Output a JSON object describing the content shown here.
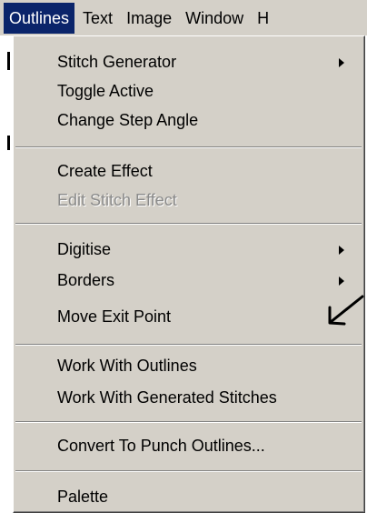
{
  "menubar": {
    "items": [
      {
        "label": "Outlines"
      },
      {
        "label": "Text"
      },
      {
        "label": "Image"
      },
      {
        "label": "Window"
      },
      {
        "label": "H"
      }
    ]
  },
  "menu": {
    "stitch_generator": "Stitch Generator",
    "toggle_active": "Toggle Active",
    "change_step_angle": "Change Step Angle",
    "create_effect": "Create Effect",
    "edit_stitch_effect": "Edit Stitch Effect",
    "digitise": "Digitise",
    "borders": "Borders",
    "move_exit_point": "Move Exit Point",
    "work_with_outlines": "Work With Outlines",
    "work_with_generated_stitches": "Work With Generated Stitches",
    "convert_to_punch_outlines": "Convert To Punch Outlines...",
    "palette": "Palette"
  },
  "icons": {
    "submenu_arrow": "chevron-right-icon",
    "annotation": "arrow-down-left-icon"
  },
  "colors": {
    "menu_bg": "#d4d0c8",
    "highlight": "#0a246a",
    "disabled_text": "#8a8a8a"
  }
}
